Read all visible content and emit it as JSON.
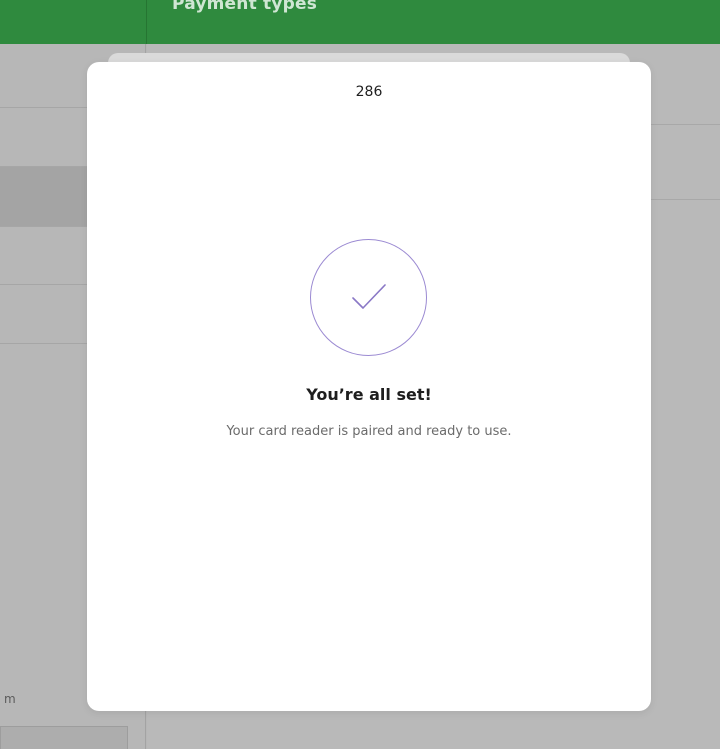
{
  "app": {
    "header_title": "Payment types",
    "left_partial_text": "m",
    "accent_color": "#2f8a3e"
  },
  "modal": {
    "code": "286",
    "icon": "checkmark-icon",
    "icon_color": "#9b8ad2",
    "title": "You’re all set!",
    "message": "Your card reader is paired and ready to use."
  }
}
